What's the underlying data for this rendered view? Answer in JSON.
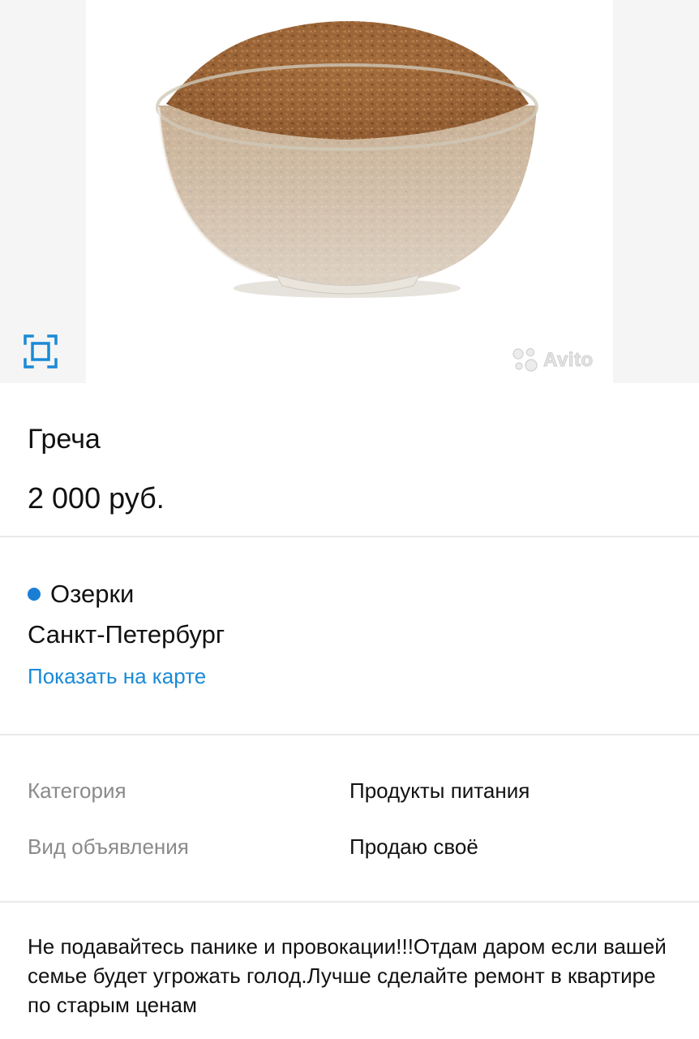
{
  "photo": {
    "watermark_text": "Avito",
    "fullscreen_icon": "fullscreen-icon",
    "accent_color": "#1a8ad6"
  },
  "listing": {
    "title": "Греча",
    "price": "2 000 руб."
  },
  "location": {
    "metro": "Озерки",
    "metro_dot_color": "#1a7fd4",
    "city": "Санкт-Петербург",
    "map_link": "Показать на карте"
  },
  "params": [
    {
      "label": "Категория",
      "value": "Продукты питания"
    },
    {
      "label": "Вид объявления",
      "value": "Продаю своё"
    }
  ],
  "description": "Не подавайтесь панике и провокации!!!Отдам даром если вашей семье будет угрожать голод.Лучше сделайте ремонт в квартире по старым ценам"
}
